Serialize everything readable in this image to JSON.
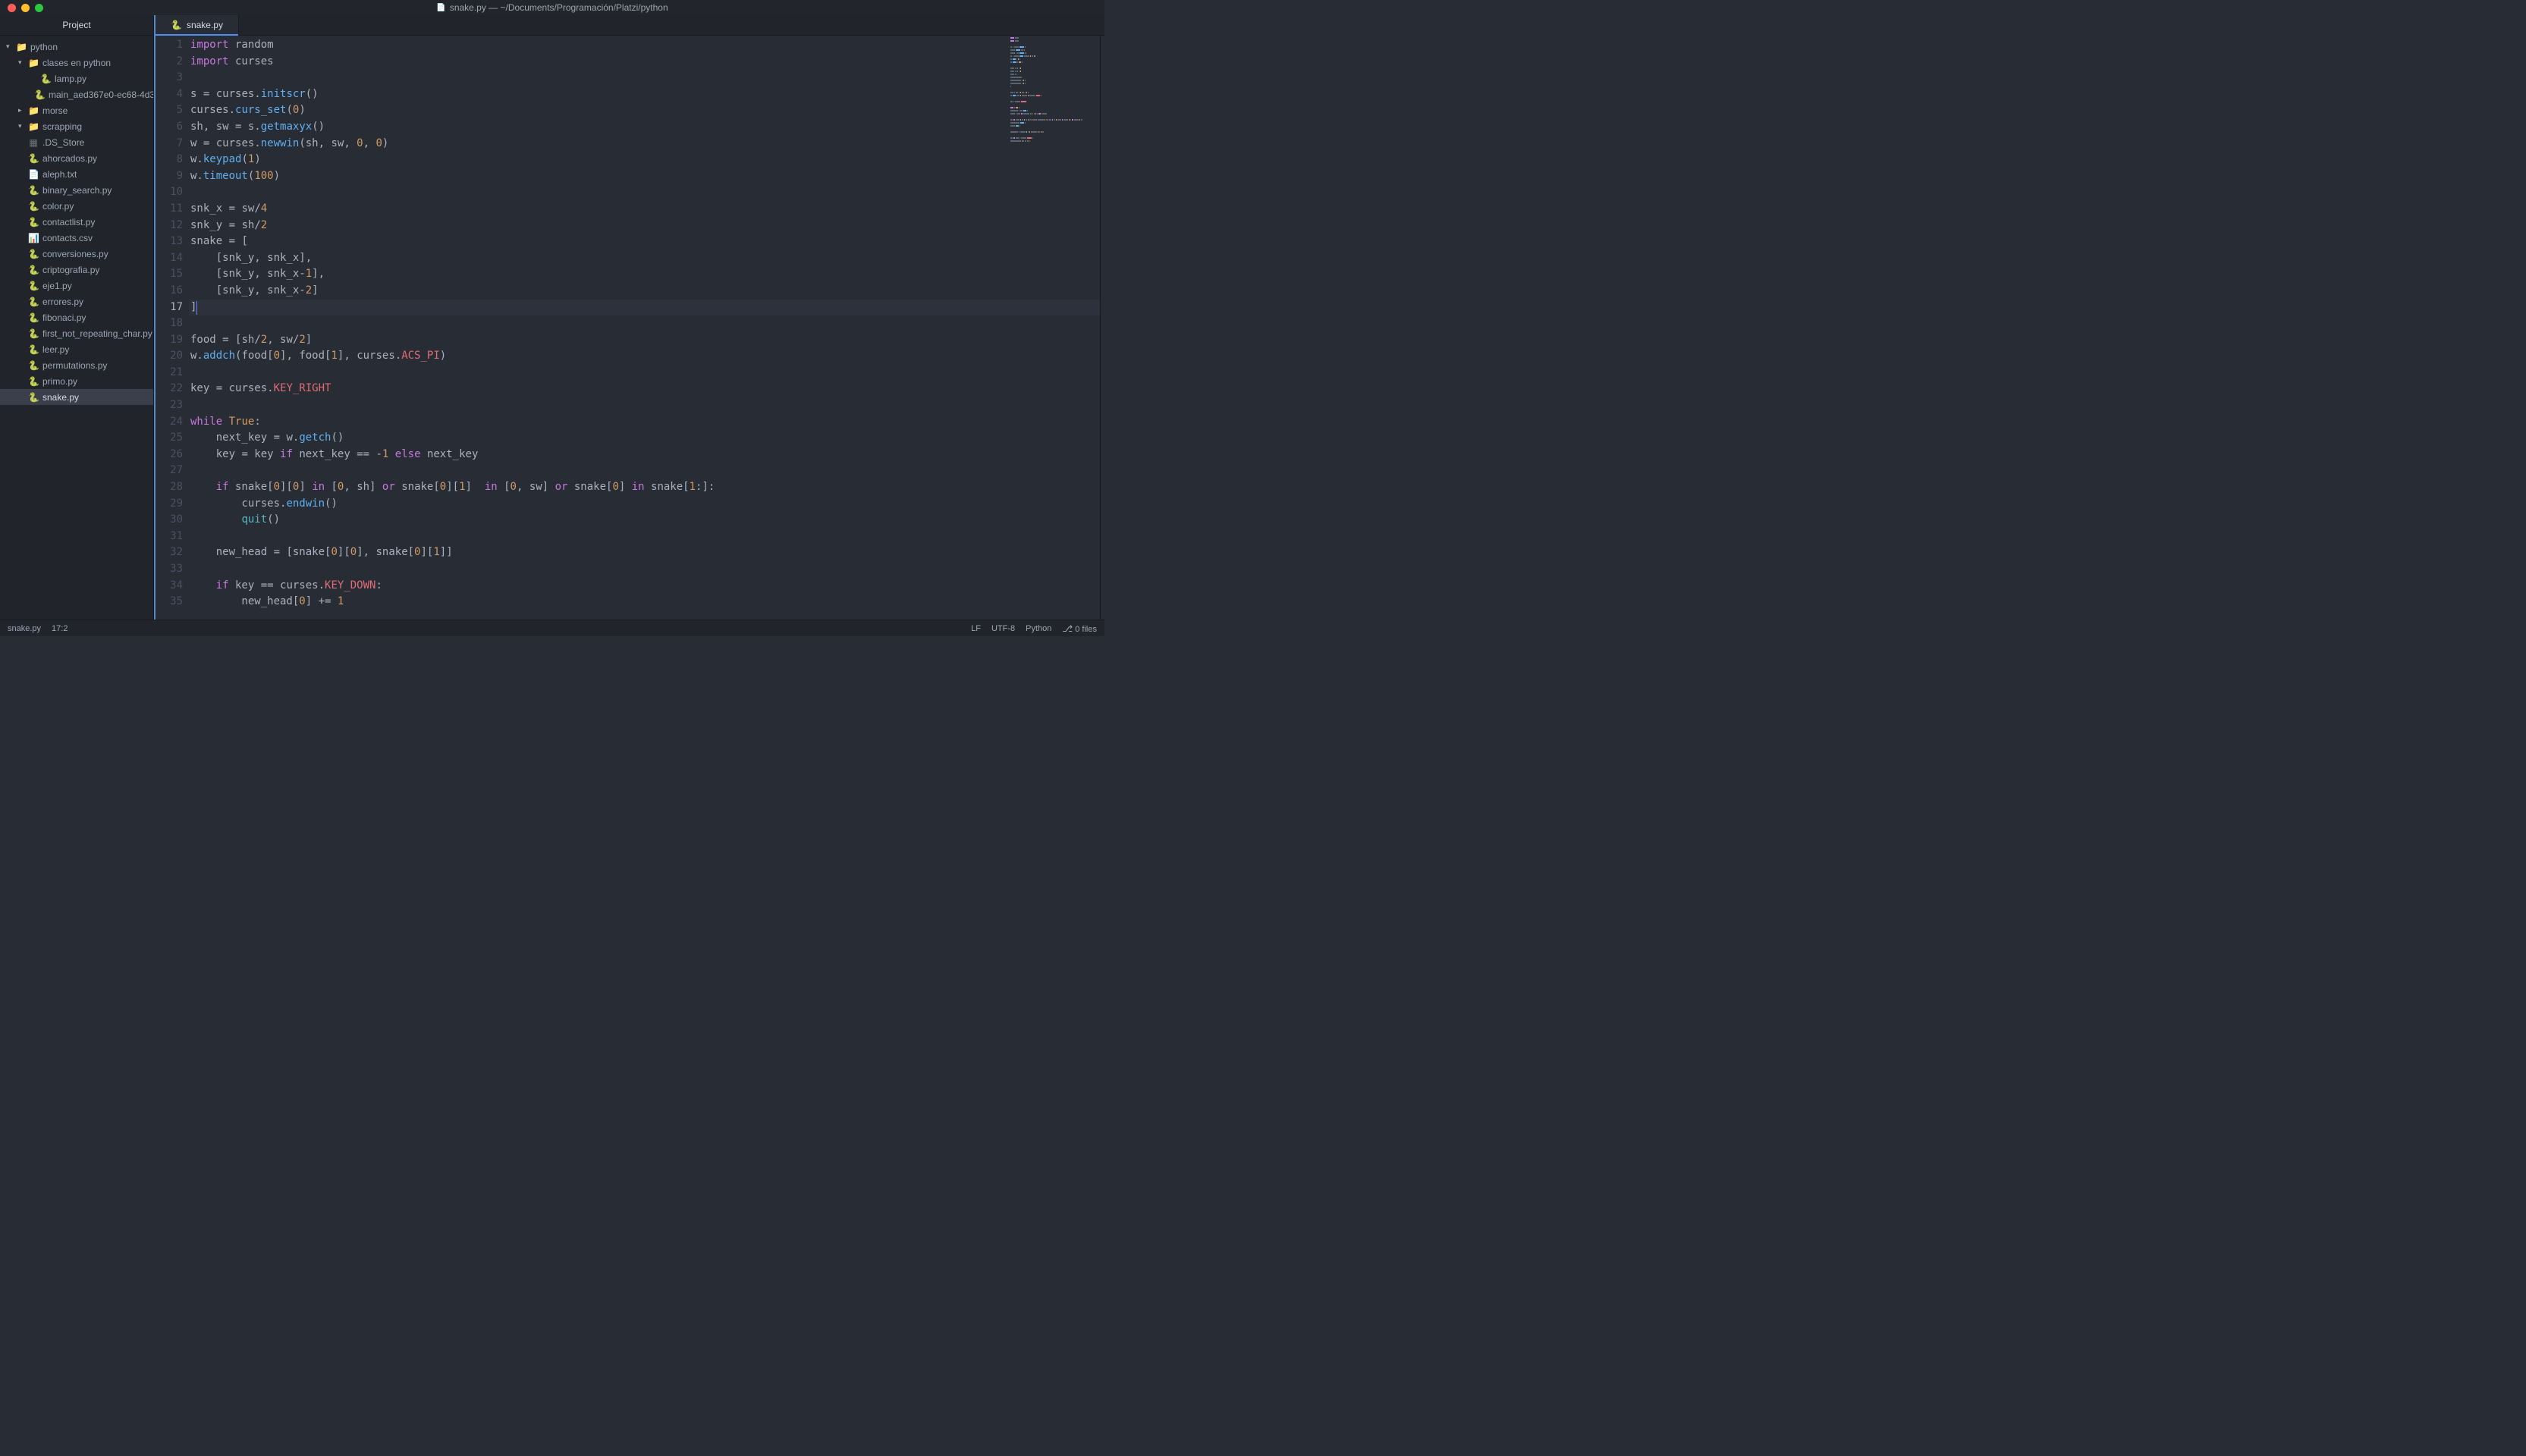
{
  "titlebar": {
    "title": "snake.py — ~/Documents/Programación/Platzi/python"
  },
  "sidebar": {
    "header": "Project",
    "root": {
      "name": "python",
      "children": [
        {
          "name": "clases en python",
          "type": "folder",
          "open": true,
          "children": [
            {
              "name": "lamp.py",
              "type": "py"
            },
            {
              "name": "main_aed367e0-ec68-4d3",
              "type": "py"
            }
          ]
        },
        {
          "name": "morse",
          "type": "folder",
          "open": false
        },
        {
          "name": "scrapping",
          "type": "folder",
          "open": true,
          "children": []
        },
        {
          "name": ".DS_Store",
          "type": "bin"
        },
        {
          "name": "ahorcados.py",
          "type": "py"
        },
        {
          "name": "aleph.txt",
          "type": "txt"
        },
        {
          "name": "binary_search.py",
          "type": "py"
        },
        {
          "name": "color.py",
          "type": "py"
        },
        {
          "name": "contactlist.py",
          "type": "py"
        },
        {
          "name": "contacts.csv",
          "type": "csv"
        },
        {
          "name": "conversiones.py",
          "type": "py"
        },
        {
          "name": "criptografia.py",
          "type": "py"
        },
        {
          "name": "eje1.py",
          "type": "py"
        },
        {
          "name": "errores.py",
          "type": "py"
        },
        {
          "name": "fibonaci.py",
          "type": "py"
        },
        {
          "name": "first_not_repeating_char.py",
          "type": "py"
        },
        {
          "name": "leer.py",
          "type": "py"
        },
        {
          "name": "permutations.py",
          "type": "py"
        },
        {
          "name": "primo.py",
          "type": "py"
        },
        {
          "name": "snake.py",
          "type": "py",
          "selected": true
        }
      ]
    }
  },
  "tab": {
    "label": "snake.py"
  },
  "code": {
    "cursor_line": 17,
    "lines": [
      [
        [
          "kw",
          "import"
        ],
        [
          "plain",
          " random"
        ]
      ],
      [
        [
          "kw",
          "import"
        ],
        [
          "plain",
          " curses"
        ]
      ],
      [],
      [
        [
          "plain",
          "s "
        ],
        [
          "op",
          "="
        ],
        [
          "plain",
          " curses."
        ],
        [
          "fn",
          "initscr"
        ],
        [
          "plain",
          "()"
        ]
      ],
      [
        [
          "plain",
          "curses."
        ],
        [
          "fn",
          "curs_set"
        ],
        [
          "plain",
          "("
        ],
        [
          "num",
          "0"
        ],
        [
          "plain",
          ")"
        ]
      ],
      [
        [
          "plain",
          "sh, sw "
        ],
        [
          "op",
          "="
        ],
        [
          "plain",
          " s."
        ],
        [
          "fn",
          "getmaxyx"
        ],
        [
          "plain",
          "()"
        ]
      ],
      [
        [
          "plain",
          "w "
        ],
        [
          "op",
          "="
        ],
        [
          "plain",
          " curses."
        ],
        [
          "fn",
          "newwin"
        ],
        [
          "plain",
          "(sh, sw, "
        ],
        [
          "num",
          "0"
        ],
        [
          "plain",
          ", "
        ],
        [
          "num",
          "0"
        ],
        [
          "plain",
          ")"
        ]
      ],
      [
        [
          "plain",
          "w."
        ],
        [
          "fn",
          "keypad"
        ],
        [
          "plain",
          "("
        ],
        [
          "num",
          "1"
        ],
        [
          "plain",
          ")"
        ]
      ],
      [
        [
          "plain",
          "w."
        ],
        [
          "fn",
          "timeout"
        ],
        [
          "plain",
          "("
        ],
        [
          "num",
          "100"
        ],
        [
          "plain",
          ")"
        ]
      ],
      [],
      [
        [
          "plain",
          "snk_x "
        ],
        [
          "op",
          "="
        ],
        [
          "plain",
          " sw"
        ],
        [
          "op",
          "/"
        ],
        [
          "num",
          "4"
        ]
      ],
      [
        [
          "plain",
          "snk_y "
        ],
        [
          "op",
          "="
        ],
        [
          "plain",
          " sh"
        ],
        [
          "op",
          "/"
        ],
        [
          "num",
          "2"
        ]
      ],
      [
        [
          "plain",
          "snake "
        ],
        [
          "op",
          "="
        ],
        [
          "plain",
          " ["
        ]
      ],
      [
        [
          "plain",
          "    [snk_y, snk_x],"
        ]
      ],
      [
        [
          "plain",
          "    [snk_y, snk_x"
        ],
        [
          "op",
          "-"
        ],
        [
          "num",
          "1"
        ],
        [
          "plain",
          "],"
        ]
      ],
      [
        [
          "plain",
          "    [snk_y, snk_x"
        ],
        [
          "op",
          "-"
        ],
        [
          "num",
          "2"
        ],
        [
          "plain",
          "]"
        ]
      ],
      [
        [
          "plain",
          "]"
        ]
      ],
      [],
      [
        [
          "plain",
          "food "
        ],
        [
          "op",
          "="
        ],
        [
          "plain",
          " [sh"
        ],
        [
          "op",
          "/"
        ],
        [
          "num",
          "2"
        ],
        [
          "plain",
          ", sw"
        ],
        [
          "op",
          "/"
        ],
        [
          "num",
          "2"
        ],
        [
          "plain",
          "]"
        ]
      ],
      [
        [
          "plain",
          "w."
        ],
        [
          "fn",
          "addch"
        ],
        [
          "plain",
          "(food["
        ],
        [
          "num",
          "0"
        ],
        [
          "plain",
          "], food["
        ],
        [
          "num",
          "1"
        ],
        [
          "plain",
          "], curses."
        ],
        [
          "const",
          "ACS_PI"
        ],
        [
          "plain",
          ")"
        ]
      ],
      [],
      [
        [
          "plain",
          "key "
        ],
        [
          "op",
          "="
        ],
        [
          "plain",
          " curses."
        ],
        [
          "const",
          "KEY_RIGHT"
        ]
      ],
      [],
      [
        [
          "kw",
          "while"
        ],
        [
          "plain",
          " "
        ],
        [
          "num",
          "True"
        ],
        [
          "plain",
          ":"
        ]
      ],
      [
        [
          "plain",
          "    next_key "
        ],
        [
          "op",
          "="
        ],
        [
          "plain",
          " w."
        ],
        [
          "fn",
          "getch"
        ],
        [
          "plain",
          "()"
        ]
      ],
      [
        [
          "plain",
          "    key "
        ],
        [
          "op",
          "="
        ],
        [
          "plain",
          " key "
        ],
        [
          "kw",
          "if"
        ],
        [
          "plain",
          " next_key "
        ],
        [
          "op",
          "=="
        ],
        [
          "plain",
          " "
        ],
        [
          "op",
          "-"
        ],
        [
          "num",
          "1"
        ],
        [
          "plain",
          " "
        ],
        [
          "kw",
          "else"
        ],
        [
          "plain",
          " next_key"
        ]
      ],
      [],
      [
        [
          "plain",
          "    "
        ],
        [
          "kw",
          "if"
        ],
        [
          "plain",
          " snake["
        ],
        [
          "num",
          "0"
        ],
        [
          "plain",
          "]["
        ],
        [
          "num",
          "0"
        ],
        [
          "plain",
          "] "
        ],
        [
          "kw",
          "in"
        ],
        [
          "plain",
          " ["
        ],
        [
          "num",
          "0"
        ],
        [
          "plain",
          ", sh] "
        ],
        [
          "kw",
          "or"
        ],
        [
          "plain",
          " snake["
        ],
        [
          "num",
          "0"
        ],
        [
          "plain",
          "]["
        ],
        [
          "num",
          "1"
        ],
        [
          "plain",
          "]  "
        ],
        [
          "kw",
          "in"
        ],
        [
          "plain",
          " ["
        ],
        [
          "num",
          "0"
        ],
        [
          "plain",
          ", sw] "
        ],
        [
          "kw",
          "or"
        ],
        [
          "plain",
          " snake["
        ],
        [
          "num",
          "0"
        ],
        [
          "plain",
          "] "
        ],
        [
          "kw",
          "in"
        ],
        [
          "plain",
          " snake["
        ],
        [
          "num",
          "1"
        ],
        [
          "plain",
          ":]:"
        ]
      ],
      [
        [
          "plain",
          "        curses."
        ],
        [
          "fn",
          "endwin"
        ],
        [
          "plain",
          "()"
        ]
      ],
      [
        [
          "plain",
          "        "
        ],
        [
          "builtin",
          "quit"
        ],
        [
          "plain",
          "()"
        ]
      ],
      [],
      [
        [
          "plain",
          "    new_head "
        ],
        [
          "op",
          "="
        ],
        [
          "plain",
          " [snake["
        ],
        [
          "num",
          "0"
        ],
        [
          "plain",
          "]["
        ],
        [
          "num",
          "0"
        ],
        [
          "plain",
          "], snake["
        ],
        [
          "num",
          "0"
        ],
        [
          "plain",
          "]["
        ],
        [
          "num",
          "1"
        ],
        [
          "plain",
          "]]"
        ]
      ],
      [],
      [
        [
          "plain",
          "    "
        ],
        [
          "kw",
          "if"
        ],
        [
          "plain",
          " key "
        ],
        [
          "op",
          "=="
        ],
        [
          "plain",
          " curses."
        ],
        [
          "const",
          "KEY_DOWN"
        ],
        [
          "plain",
          ":"
        ]
      ],
      [
        [
          "plain",
          "        new_head["
        ],
        [
          "num",
          "0"
        ],
        [
          "plain",
          "] "
        ],
        [
          "op",
          "+="
        ],
        [
          "plain",
          " "
        ],
        [
          "num",
          "1"
        ]
      ]
    ]
  },
  "statusbar": {
    "filename": "snake.py",
    "position": "17:2",
    "line_ending": "LF",
    "encoding": "UTF-8",
    "language": "Python",
    "git": "0 files"
  }
}
